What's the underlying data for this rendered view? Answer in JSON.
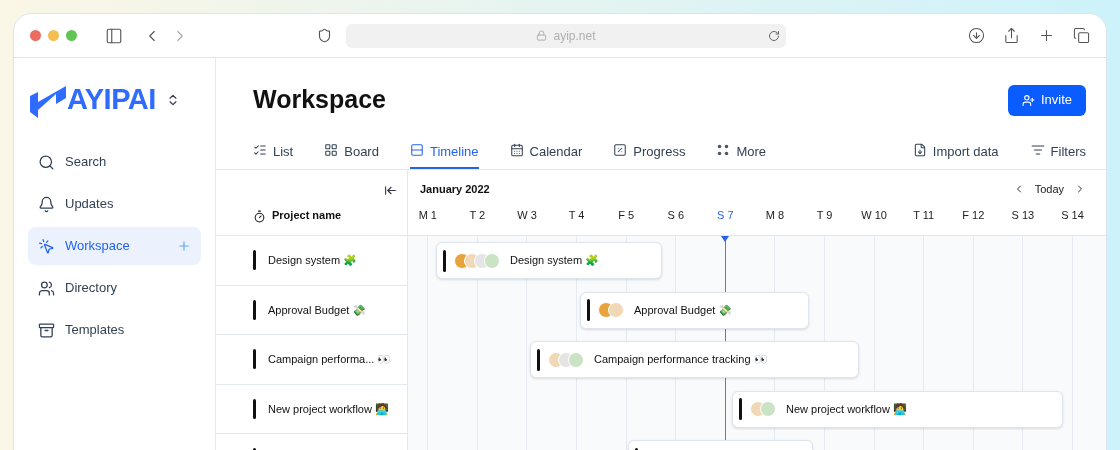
{
  "browser": {
    "url": "ayip.net"
  },
  "sidebar": {
    "logo": "AYIPAI",
    "items": [
      {
        "label": "Search",
        "selected": false
      },
      {
        "label": "Updates",
        "selected": false
      },
      {
        "label": "Workspace",
        "selected": true
      },
      {
        "label": "Directory",
        "selected": false
      },
      {
        "label": "Templates",
        "selected": false
      }
    ]
  },
  "title": "Workspace",
  "invite_button": "Invite",
  "tabs": [
    {
      "label": "List",
      "selected": false
    },
    {
      "label": "Board",
      "selected": false
    },
    {
      "label": "Timeline",
      "selected": true
    },
    {
      "label": "Calendar",
      "selected": false
    },
    {
      "label": "Progress",
      "selected": false
    },
    {
      "label": "More",
      "selected": false
    }
  ],
  "actions": [
    {
      "label": "Import data"
    },
    {
      "label": "Filters"
    }
  ],
  "table": {
    "column": "Project name",
    "month": "January 2022",
    "today_button": "Today",
    "days": [
      {
        "label": "M 1",
        "selected": false
      },
      {
        "label": "T 2",
        "selected": false
      },
      {
        "label": "W 3",
        "selected": false
      },
      {
        "label": "T 4",
        "selected": false
      },
      {
        "label": "F 5",
        "selected": false
      },
      {
        "label": "S 6",
        "selected": false
      },
      {
        "label": "S 7",
        "selected": true
      },
      {
        "label": "M 8",
        "selected": false
      },
      {
        "label": "T 9",
        "selected": false
      },
      {
        "label": "W 10",
        "selected": false
      },
      {
        "label": "T 11",
        "selected": false
      },
      {
        "label": "F 12",
        "selected": false
      },
      {
        "label": "S 13",
        "selected": false
      },
      {
        "label": "S 14",
        "selected": false
      }
    ],
    "rows": [
      {
        "name": "Design system 🧩",
        "bar": "Design system 🧩",
        "avatars": [
          {
            "color": "#e8a33c"
          },
          {
            "color": "#f1d9b8"
          },
          {
            "color": "#e5e5e5"
          },
          {
            "color": "#c9e3c4"
          }
        ]
      },
      {
        "name": "Approval Budget 💸",
        "bar": "Approval Budget 💸",
        "avatars": [
          {
            "color": "#e8a33c"
          },
          {
            "color": "#f1d9b8"
          }
        ]
      },
      {
        "name": "Campaign performa... 👀",
        "bar": "Campaign performance tracking 👀",
        "avatars": [
          {
            "color": "#f1d9b8"
          },
          {
            "color": "#e5e5e5"
          },
          {
            "color": "#c9e3c4"
          }
        ]
      },
      {
        "name": "New project workflow 🧑‍💻",
        "bar": "New project workflow 🧑‍💻",
        "avatars": [
          {
            "color": "#f1d9b8"
          },
          {
            "color": "#c9e3c4"
          }
        ]
      },
      {
        "kind": "partial"
      }
    ]
  }
}
